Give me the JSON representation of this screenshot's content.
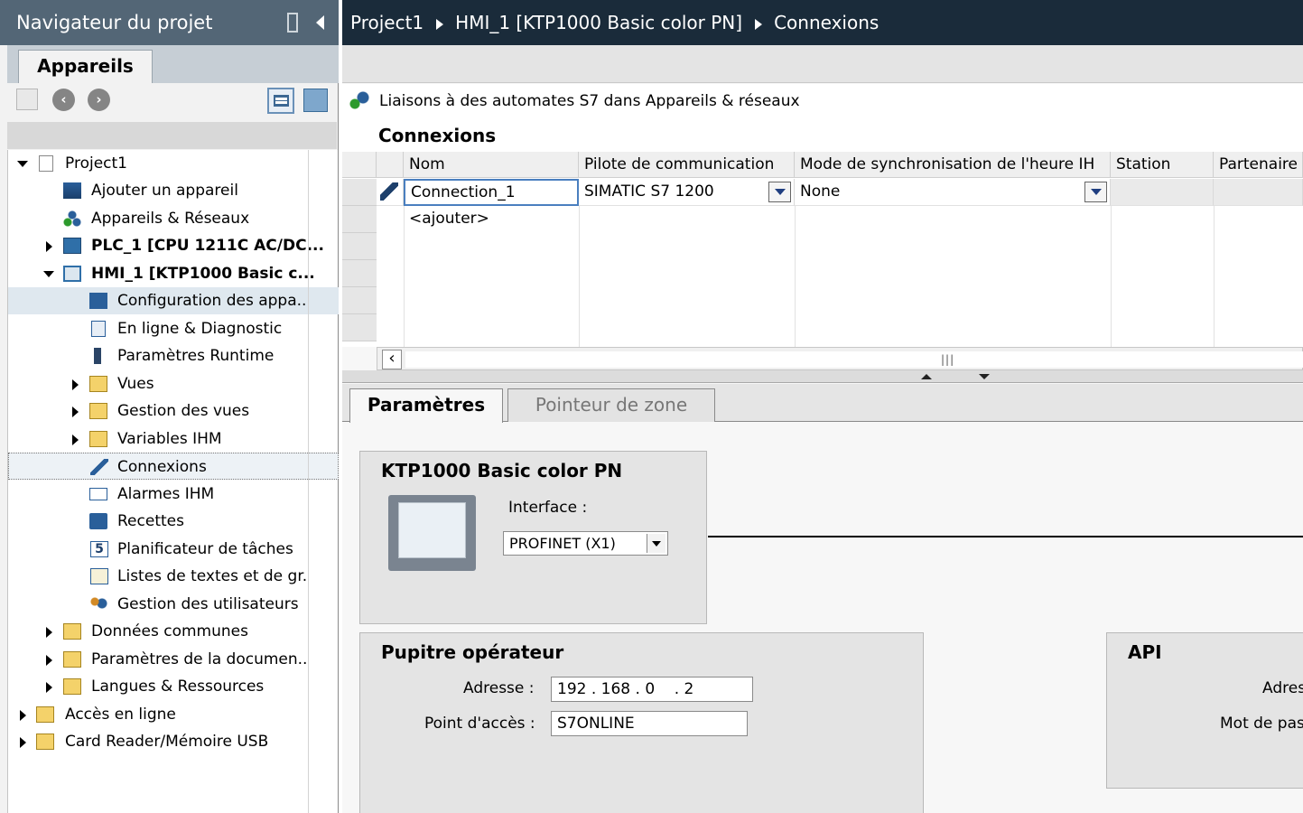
{
  "navigator": {
    "title": "Navigateur du projet",
    "tab": "Appareils",
    "tree": [
      {
        "label": "Project1"
      },
      {
        "label": "Ajouter un appareil"
      },
      {
        "label": "Appareils & Réseaux"
      },
      {
        "label": "PLC_1 [CPU 1211C AC/DC..."
      },
      {
        "label": "HMI_1 [KTP1000 Basic c..."
      },
      {
        "label": "Configuration des appa.."
      },
      {
        "label": "En ligne & Diagnostic"
      },
      {
        "label": "Paramètres Runtime"
      },
      {
        "label": "Vues"
      },
      {
        "label": "Gestion des vues"
      },
      {
        "label": "Variables IHM"
      },
      {
        "label": "Connexions"
      },
      {
        "label": "Alarmes IHM"
      },
      {
        "label": "Recettes"
      },
      {
        "label": "Planificateur de tâches"
      },
      {
        "label": "Listes de textes et de gr."
      },
      {
        "label": "Gestion des utilisateurs"
      },
      {
        "label": "Données communes"
      },
      {
        "label": "Paramètres de la documen.."
      },
      {
        "label": "Langues & Ressources"
      },
      {
        "label": "Accès en ligne"
      },
      {
        "label": "Card Reader/Mémoire USB"
      }
    ],
    "icons": [
      "new-item-icon",
      "back-icon",
      "forward-icon",
      "list-view-icon",
      "export-icon"
    ]
  },
  "breadcrumb": {
    "items": [
      "Project1",
      "HMI_1 [KTP1000 Basic color PN]",
      "Connexions"
    ]
  },
  "editor": {
    "link_text": "Liaisons à des automates S7 dans Appareils & réseaux",
    "section_title": "Connexions",
    "columns": [
      "Nom",
      "Pilote de communication",
      "Mode de synchronisation de l'heure IH",
      "Station",
      "Partenaire"
    ],
    "rows": [
      {
        "name": "Connection_1",
        "driver": "SIMATIC S7 1200",
        "sync_mode": "None",
        "station": "",
        "partner": ""
      }
    ],
    "add_row": "<ajouter>",
    "tabs": [
      "Paramètres",
      "Pointeur de zone"
    ],
    "device_box": {
      "title": "KTP1000 Basic color PN",
      "interface_label": "Interface :",
      "interface_value": "PROFINET (X1)"
    },
    "operator_box": {
      "title": "Pupitre opérateur",
      "address_label": "Adresse :",
      "address_value": "192 . 168 . 0    . 2",
      "access_label": "Point d'accès :",
      "access_value": "S7ONLINE"
    },
    "api_box": {
      "title": "API",
      "address_label": "Adres",
      "password_label": "Mot de pas"
    }
  }
}
